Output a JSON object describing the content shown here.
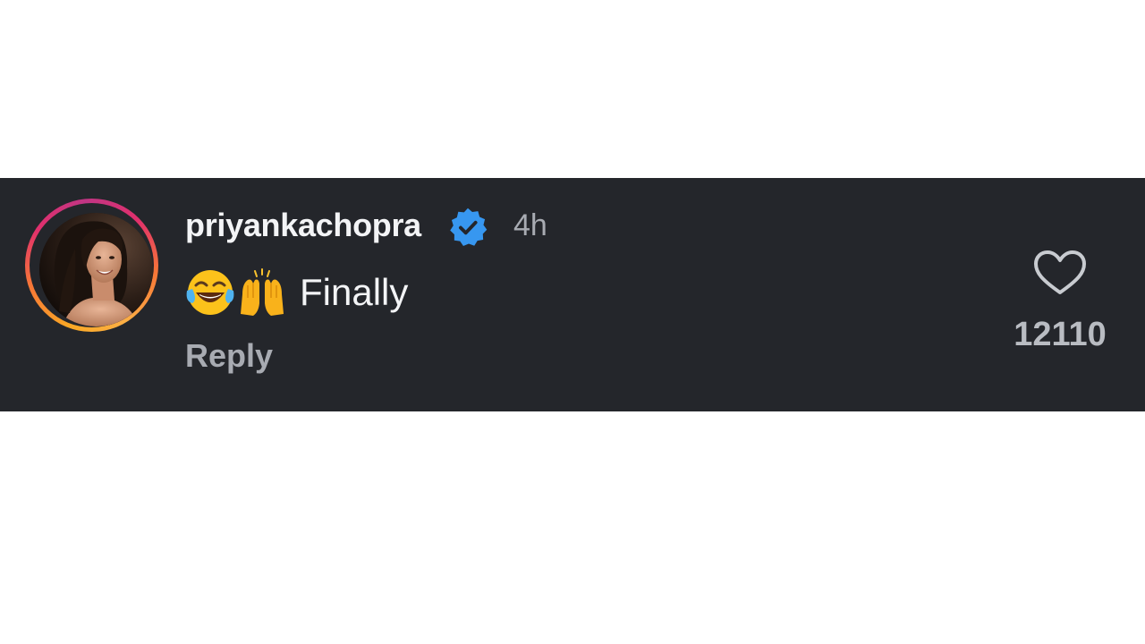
{
  "comment": {
    "username": "priyankachopra",
    "verified_icon": "verified-badge-icon",
    "time_ago": "4h",
    "emojis": [
      "face-with-tears-of-joy-icon",
      "raising-hands-icon"
    ],
    "text": "Finally",
    "reply_label": "Reply",
    "like_icon": "heart-outline-icon",
    "like_count": "12110"
  },
  "colors": {
    "background": "#24262b",
    "verified_blue": "#3797f0",
    "primary_text": "#f3f4f6",
    "secondary_text": "#a8abb2"
  }
}
